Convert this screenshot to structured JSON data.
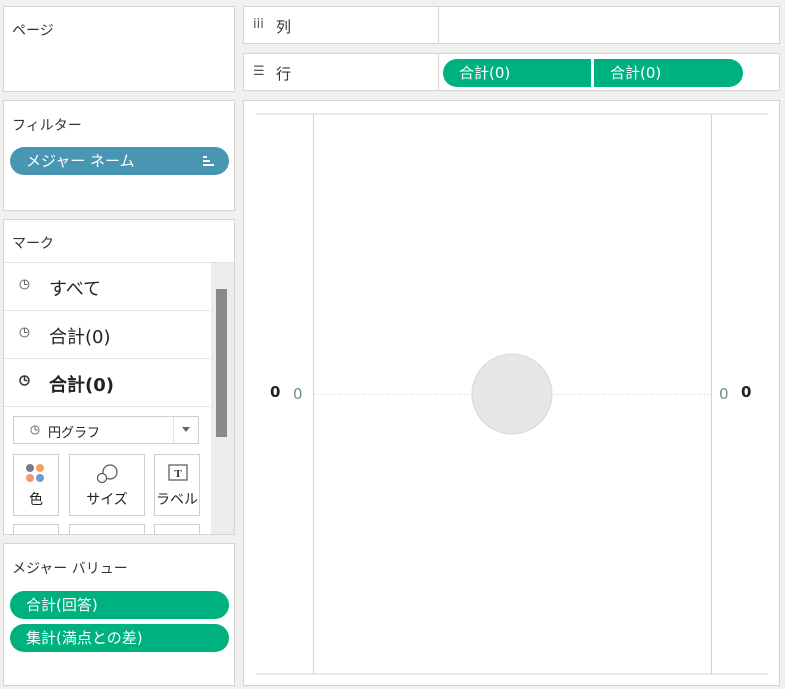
{
  "pages": {
    "title": "ページ"
  },
  "columns": {
    "label": "列"
  },
  "rows": {
    "label": "行",
    "pills": [
      "合計(0)",
      "合計(0)"
    ]
  },
  "filters": {
    "title": "フィルター",
    "pill": "メジャー ネーム"
  },
  "marks": {
    "title": "マーク",
    "items": [
      "すべて",
      "合計(0)",
      "合計(0)"
    ],
    "mark_type": "円グラフ",
    "buttons": {
      "color": "色",
      "size": "サイズ",
      "label": "ラベル"
    }
  },
  "measure_values": {
    "title": "メジャー バリュー",
    "pills": [
      "合計(回答)",
      "集計(満点との差)"
    ]
  },
  "view": {
    "left_axis_value": "0",
    "right_axis_value": "0",
    "left_axis_title": "0",
    "right_axis_title": "0"
  },
  "colors": {
    "green_pill": "#00b180",
    "blue_pill": "#4996b2",
    "pie": "#e6e6e6"
  }
}
